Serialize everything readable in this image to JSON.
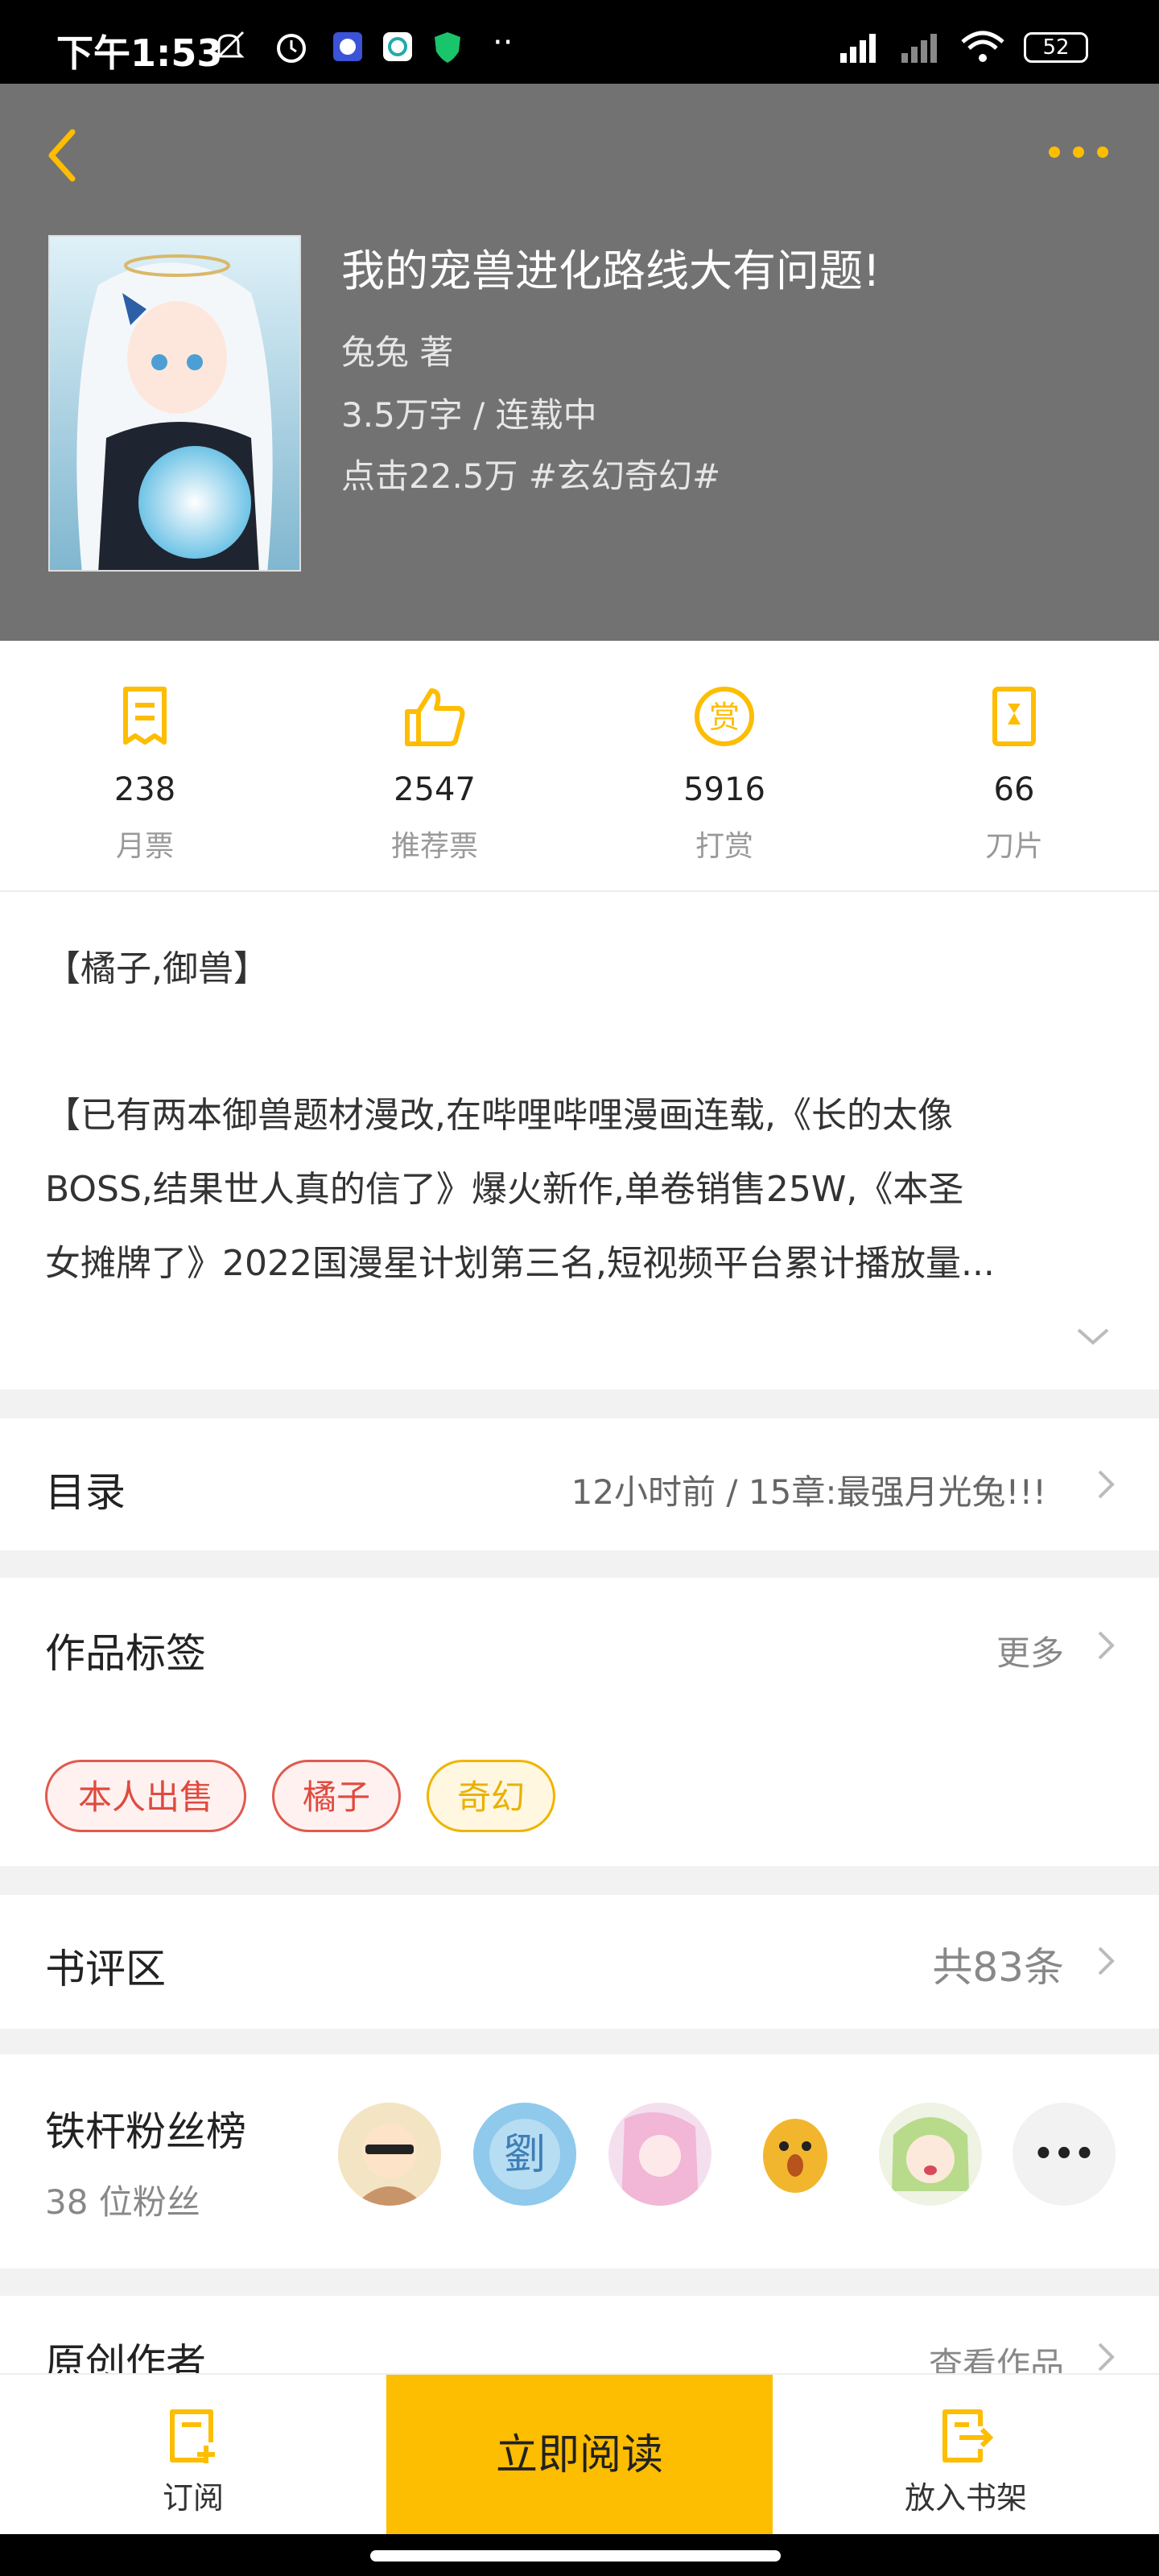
{
  "status_bar": {
    "time": "下午1:53",
    "battery": "52"
  },
  "book": {
    "title": "我的宠兽进化路线大有问题!",
    "author_line": "兔兔  著",
    "words_status": "3.5万字 / 连载中",
    "clicks_genre": "点击22.5万  #玄幻奇幻#"
  },
  "stats": [
    {
      "value": "238",
      "label": "月票",
      "icon": "ticket-icon"
    },
    {
      "value": "2547",
      "label": "推荐票",
      "icon": "thumbs-up-icon"
    },
    {
      "value": "5916",
      "label": "打赏",
      "icon": "reward-coin-icon"
    },
    {
      "value": "66",
      "label": "刀片",
      "icon": "blade-icon"
    }
  ],
  "intro": {
    "line1": "【橘子,御兽】",
    "line2": "【已有两本御兽题材漫改,在哔哩哔哩漫画连载,《长的太像",
    "line3": "BOSS,结果世人真的信了》爆火新作,单卷销售25W,《本圣",
    "line4": "女摊牌了》2022国漫星计划第三名,短视频平台累计播放量..."
  },
  "catalog": {
    "title": "目录",
    "latest": "12小时前 / 15章:最强月光兔!!!"
  },
  "tags": {
    "title": "作品标签",
    "more": "更多",
    "items": [
      "本人出售",
      "橘子",
      "奇幻"
    ]
  },
  "reviews": {
    "title": "书评区",
    "count": "共83条"
  },
  "fans": {
    "title": "铁杆粉丝榜",
    "count": "38 位粉丝",
    "more_label": "•••"
  },
  "author": {
    "title": "原创作者",
    "link": "查看作品"
  },
  "bottom": {
    "subscribe": "订阅",
    "read_now": "立即阅读",
    "add_shelf": "放入书架"
  },
  "colors": {
    "accent": "#fdbd00",
    "header_bg": "#727272"
  }
}
